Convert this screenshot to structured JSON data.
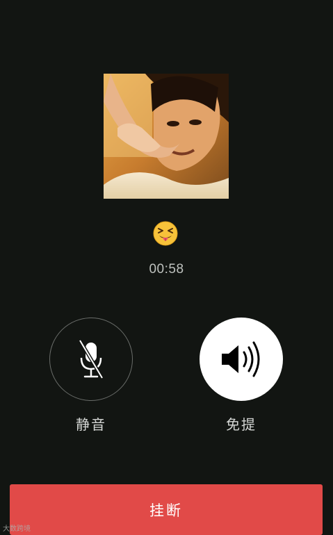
{
  "call": {
    "caller_emoji": "😝",
    "timer": "00:58"
  },
  "controls": {
    "mute_label": "静音",
    "mute_icon": "microphone-muted-icon",
    "speaker_label": "免提",
    "speaker_icon": "speaker-icon",
    "speaker_active": true
  },
  "hangup": {
    "label": "挂断"
  },
  "watermark": {
    "text": "大数跨境"
  },
  "colors": {
    "background": "#121512",
    "hangup": "#e14a48",
    "speaker_active_bg": "#ffffff"
  }
}
